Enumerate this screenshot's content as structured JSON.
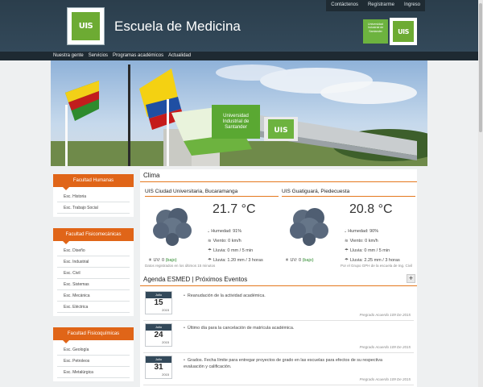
{
  "top_links": [
    "Contáctenos",
    "Regístrarme",
    "Ingreso"
  ],
  "site": {
    "logo_text": "UIS",
    "title": "Escuela de Medicina",
    "uni_badge_text": "Universidad Industrial de Santander",
    "uni_logo_text": "UIS"
  },
  "nav": [
    "Nuestra gente",
    "Servicios",
    "Programas académicos",
    "Actualidad"
  ],
  "hero": {
    "sign_text": "Universidad Industrial de Santander",
    "sign_logo": "UIS"
  },
  "faculties": [
    {
      "name": "Facultad Humanas",
      "items": [
        "Esc. Historia",
        "Esc. Trabajo Social"
      ]
    },
    {
      "name": "Facultad Fisicomecánicas",
      "items": [
        "Esc. Diseño",
        "Esc. Industrial",
        "Esc. Civil",
        "Esc. Sistemas",
        "Esc. Mecánica",
        "Esc. Eléctrica"
      ]
    },
    {
      "name": "Facultad Fisicoquímicas",
      "items": [
        "Esc. Geología",
        "Esc. Petroleos",
        "Esc. Metalúrgica"
      ]
    }
  ],
  "clima": {
    "title": "Clima",
    "stations": [
      {
        "name": "UIS Ciudad Universitaria, Bucaramanga",
        "temp": "21.7 °C",
        "humidity": "Humedad: 91%",
        "wind": "Viento: 0 km/h",
        "rain_rate": "Lluvia: 0 mm / 5 min",
        "rain_total": "Lluvia: 1.20 mm / 3 horas",
        "uv_label": "UV: 0",
        "uv_level": "(bajo)"
      },
      {
        "name": "UIS Guatiguará, Piedecuesta",
        "temp": "20.8 °C",
        "humidity": "Humedad: 90%",
        "wind": "Viento: 0 km/h",
        "rain_rate": "Lluvia: 0 mm / 5 min",
        "rain_total": "Lluvia: 2.25 mm / 3 horas",
        "uv_label": "UV: 0",
        "uv_level": "(bajo)"
      }
    ],
    "note_left": "Datos registrados en los últimos 15 minutos",
    "note_right": "Por el Grupo GPH de la escuela de Ing. Civil"
  },
  "agenda": {
    "title": "Agenda ESMED | Próximos Eventos",
    "add_label": "+",
    "events": [
      {
        "month": "Julio",
        "day": "15",
        "year": "2015",
        "text": "Reanudación de la actividad académica.",
        "note": "Pregrado Acuerdo 109 De 2015"
      },
      {
        "month": "Julio",
        "day": "24",
        "year": "2015",
        "text": "Último día para la cancelación de matrícula académica.",
        "note": "Pregrado Acuerdo 109 De 2015"
      },
      {
        "month": "Julio",
        "day": "31",
        "year": "2015",
        "text": "Grados. Fecha límite para entregar proyectos de grado en las escuelas para efectos de su respectiva evaluación y calificación.",
        "note": "Pregrado Acuerdo 109 De 2015"
      }
    ]
  },
  "colors": {
    "header": "#2b3e4c",
    "accent": "#e06518",
    "brand_green": "#6dab33"
  }
}
